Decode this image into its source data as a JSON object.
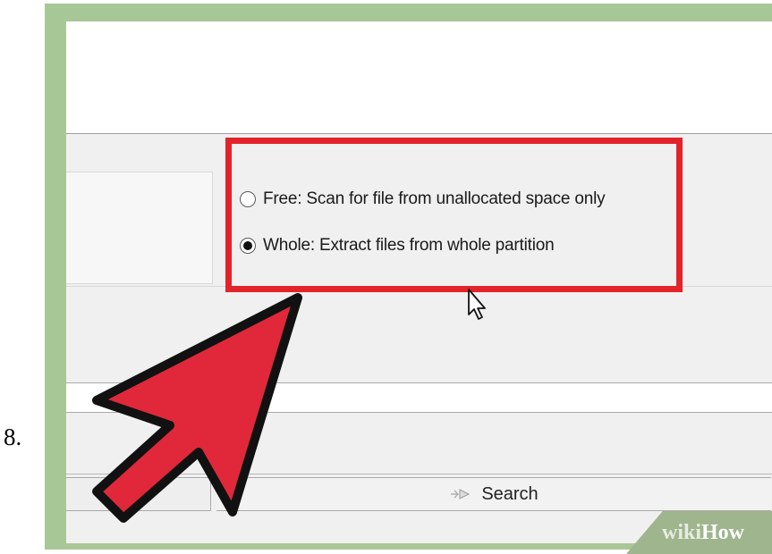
{
  "step": {
    "number": "8."
  },
  "options": {
    "free_label": "Free: Scan for file from unallocated space only",
    "whole_label": "Whole: Extract files from whole partition",
    "selected": "whole"
  },
  "search": {
    "label": "Search",
    "icon": "search-arrow-icon"
  },
  "watermark": {
    "wiki": "wiki",
    "how": "How"
  },
  "colors": {
    "frame": "#a8c796",
    "highlight": "#e3232a",
    "arrow_fill": "#e0283a",
    "arrow_outline": "#111111"
  }
}
